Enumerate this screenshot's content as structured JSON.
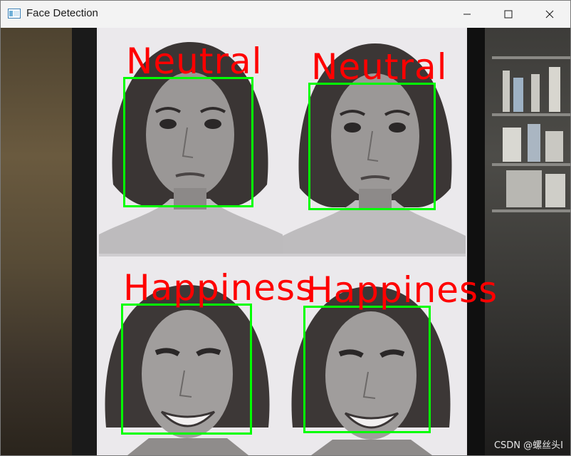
{
  "window": {
    "title": "Face Detection",
    "controls": {
      "minimize": "minimize-icon",
      "maximize": "maximize-icon",
      "close": "close-icon"
    }
  },
  "detections": [
    {
      "label": "Neutral"
    },
    {
      "label": "Neutral"
    },
    {
      "label": "Happiness"
    },
    {
      "label": "Happiness"
    }
  ],
  "colors": {
    "box": "#00ff00",
    "label": "#ff0000",
    "titlebar": "#f3f3f3"
  },
  "watermark": "CSDN @螺丝头I"
}
